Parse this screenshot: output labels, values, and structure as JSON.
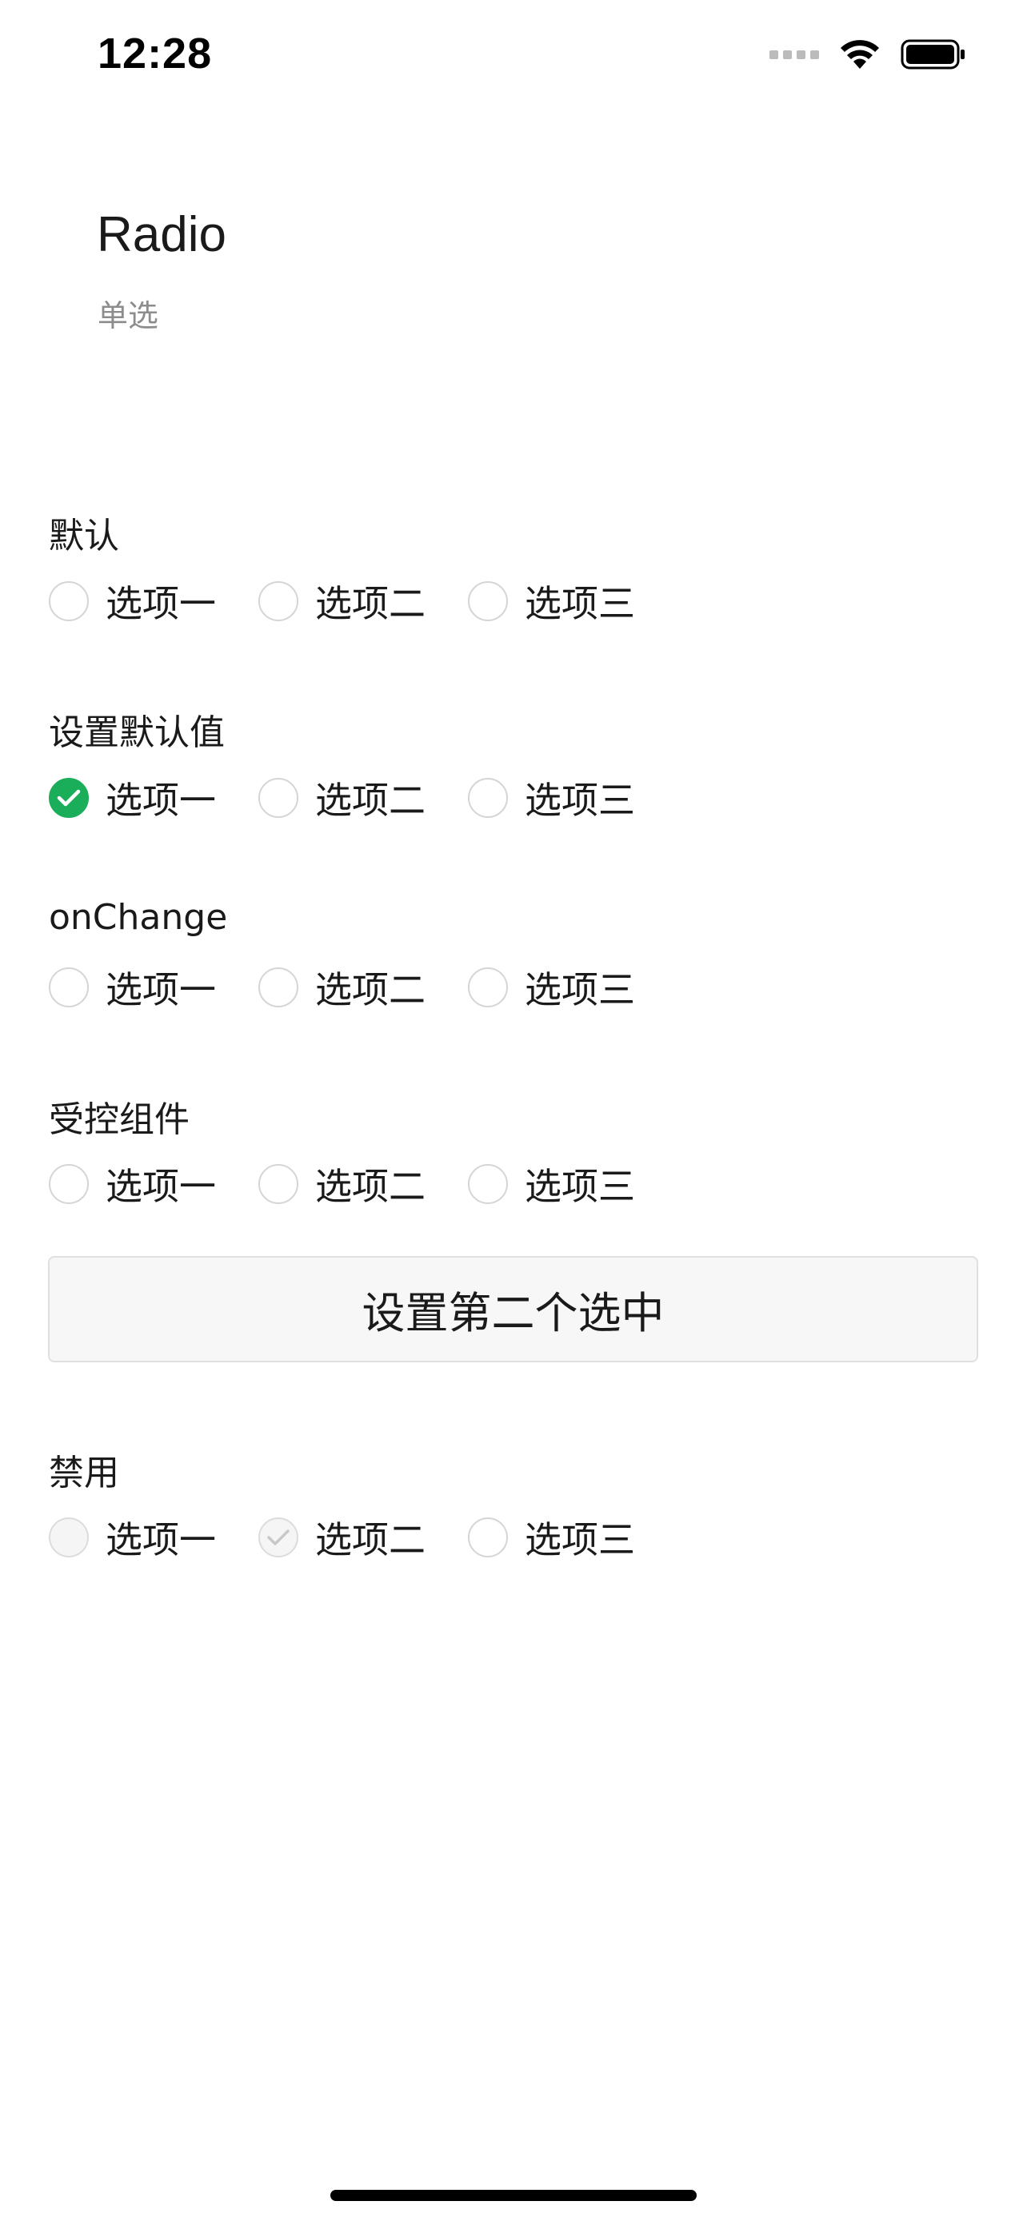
{
  "status_bar": {
    "time": "12:28",
    "icons": [
      "signal-dots-icon",
      "wifi-icon",
      "battery-icon"
    ]
  },
  "header": {
    "title": "Radio",
    "subtitle": "单选"
  },
  "sections": {
    "default": {
      "title": "默认",
      "options": [
        "选项一",
        "选项二",
        "选项三"
      ],
      "selected": null
    },
    "default_value": {
      "title": "设置默认值",
      "options": [
        "选项一",
        "选项二",
        "选项三"
      ],
      "selected": "选项一"
    },
    "on_change": {
      "title": "onChange",
      "options": [
        "选项一",
        "选项二",
        "选项三"
      ],
      "selected": null
    },
    "controlled": {
      "title": "受控组件",
      "options": [
        "选项一",
        "选项二",
        "选项三"
      ],
      "selected": null,
      "button_label": "设置第二个选中"
    },
    "disabled": {
      "title": "禁用",
      "options": [
        "选项一",
        "选项二",
        "选项三"
      ],
      "selected": "选项二",
      "disabled_options": [
        "选项一",
        "选项二"
      ]
    }
  },
  "colors": {
    "accent": "#1aad5a",
    "border": "#d5d5d5",
    "subtitle": "#8c8c8c"
  }
}
